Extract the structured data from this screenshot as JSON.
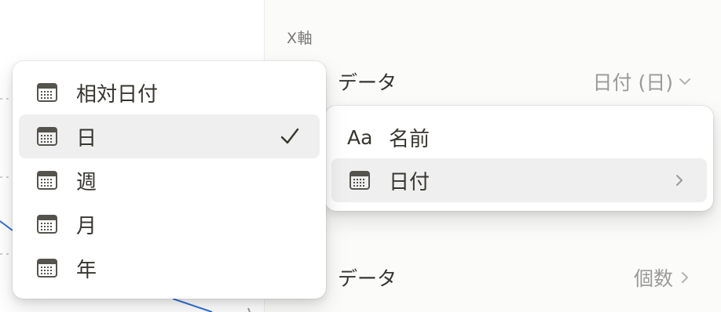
{
  "settings": {
    "x_axis_label": "X軸",
    "data_row_1": {
      "label": "データ",
      "value": "日付 (日)"
    },
    "data_row_2": {
      "label": "データ",
      "value": "個数"
    },
    "partial_row_label": "データ"
  },
  "date_menu": {
    "items": [
      {
        "label": "相対日付",
        "icon": "calendar-icon",
        "selected": false
      },
      {
        "label": "日",
        "icon": "calendar-icon",
        "selected": true
      },
      {
        "label": "週",
        "icon": "calendar-icon",
        "selected": false
      },
      {
        "label": "月",
        "icon": "calendar-icon",
        "selected": false
      },
      {
        "label": "年",
        "icon": "calendar-icon",
        "selected": false
      }
    ]
  },
  "field_menu": {
    "items": [
      {
        "label": "名前",
        "icon_text": "Aa",
        "icon": "text-property-icon"
      },
      {
        "label": "日付",
        "icon": "calendar-icon",
        "has_submenu": true
      }
    ]
  },
  "colors": {
    "accent_line": "#2f6fd6",
    "panel_bg": "#fbfbfa",
    "selected_bg": "#efefef",
    "muted_text": "#9b9a97"
  }
}
